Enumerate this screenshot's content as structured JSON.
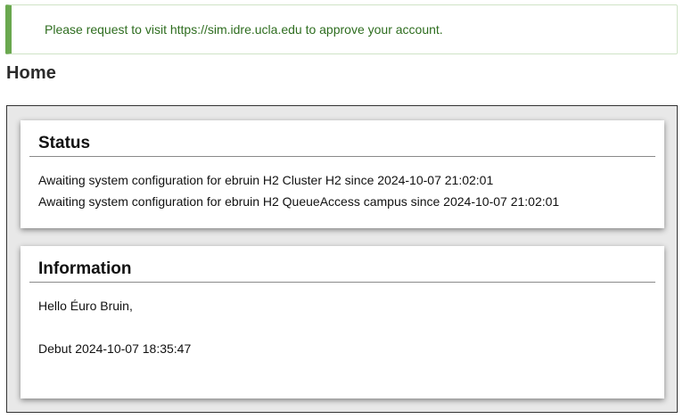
{
  "alert": {
    "message": "Please request to visit https://sim.idre.ucla.edu to approve your account.",
    "accent_color": "#6aa84f"
  },
  "page": {
    "title": "Home"
  },
  "status_panel": {
    "heading": "Status",
    "lines": [
      "Awaiting system configuration for ebruin H2 Cluster H2 since 2024-10-07 21:02:01",
      "Awaiting system configuration for ebruin H2 QueueAccess campus since 2024-10-07 21:02:01"
    ]
  },
  "information_panel": {
    "heading": "Information",
    "greeting": "Hello Éuro Bruin,",
    "debut": "Debut 2024-10-07 18:35:47"
  }
}
